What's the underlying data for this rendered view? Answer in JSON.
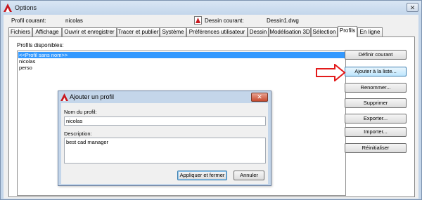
{
  "window": {
    "title": "Options"
  },
  "header": {
    "current_profile_label": "Profil courant:",
    "current_profile_value": "nicolas",
    "current_drawing_label": "Dessin courant:",
    "current_drawing_value": "Dessin1.dwg"
  },
  "tabs": [
    {
      "label": "Fichiers"
    },
    {
      "label": "Affichage"
    },
    {
      "label": "Ouvrir et enregistrer"
    },
    {
      "label": "Tracer et publier"
    },
    {
      "label": "Système"
    },
    {
      "label": "Préférences utilisateur"
    },
    {
      "label": "Dessin"
    },
    {
      "label": "Modélisation 3D"
    },
    {
      "label": "Sélection"
    },
    {
      "label": "Profils",
      "active": true
    },
    {
      "label": "En ligne"
    }
  ],
  "profiles": {
    "label": "Profils disponibles:",
    "items": [
      "<<Profil sans nom>>",
      "nicolas",
      "perso"
    ],
    "selected_index": 0
  },
  "actions": {
    "set_current": "Définir courant",
    "add_to_list": "Ajouter à la liste...",
    "rename": "Renommer...",
    "delete": "Supprimer",
    "export": "Exporter...",
    "import": "Importer...",
    "reset": "Réinitialiser"
  },
  "dialog": {
    "title": "Ajouter un profil",
    "name_label": "Nom du profil:",
    "name_value": "nicolas",
    "description_label": "Description:",
    "description_value": "best cad manager",
    "apply_close": "Appliquer et fermer",
    "cancel": "Annuler"
  },
  "colors": {
    "selection": "#3399ff",
    "arrow": "#e31b1b",
    "close_button": "#c74a2f"
  }
}
